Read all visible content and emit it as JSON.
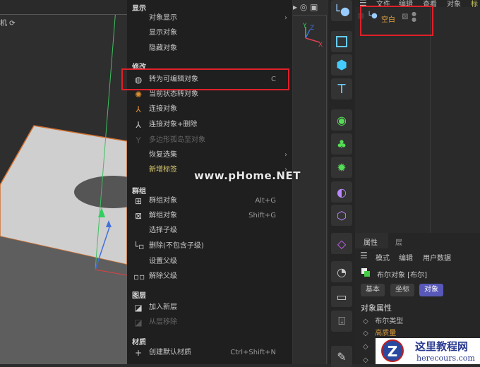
{
  "viewport": {
    "label": "机 ⟳",
    "axes": {
      "x": "X",
      "y": "Y",
      "z": "Z"
    }
  },
  "menu": {
    "sections": [
      {
        "title": "显示",
        "items": [
          {
            "label": "对象显示",
            "submenu": true
          },
          {
            "label": "显示对象"
          },
          {
            "label": "隐藏对象"
          }
        ]
      },
      {
        "title": "修改",
        "items": [
          {
            "label": "转为可编辑对象",
            "shortcut": "C",
            "icon": "make-editable-icon"
          },
          {
            "label": "当前状态转对象",
            "icon": "current-state-icon"
          },
          {
            "label": "连接对象",
            "icon": "connect-icon"
          },
          {
            "label": "连接对象+删除",
            "icon": "connect-delete-icon"
          },
          {
            "label": "多边形孤岛至对象",
            "icon": "polygon-island-icon",
            "disabled": true
          },
          {
            "label": "恢复选集",
            "submenu": true
          },
          {
            "label": "新增标签",
            "submenu": true
          }
        ]
      },
      {
        "title": "群组",
        "items": [
          {
            "label": "群组对象",
            "shortcut": "Alt+G",
            "icon": "group-icon"
          },
          {
            "label": "解组对象",
            "shortcut": "Shift+G",
            "icon": "ungroup-icon"
          },
          {
            "label": "选择子级"
          },
          {
            "label": "删除(不包含子级)",
            "icon": "delete-no-children-icon"
          },
          {
            "label": "设置父级"
          },
          {
            "label": "解除父级",
            "icon": "unparent-icon"
          }
        ]
      },
      {
        "title": "图层",
        "items": [
          {
            "label": "加入新层",
            "icon": "add-layer-icon"
          },
          {
            "label": "从层移除",
            "icon": "remove-layer-icon",
            "disabled": true
          }
        ]
      },
      {
        "title": "材质",
        "items": [
          {
            "label": "创建默认材质",
            "shortcut": "Ctrl+Shift+N",
            "icon": "plus-icon"
          }
        ]
      }
    ]
  },
  "object_manager": {
    "menubar": [
      "文件",
      "编辑",
      "查看",
      "对象",
      "标"
    ],
    "object": {
      "name": "空白"
    }
  },
  "attributes": {
    "tabs": [
      "属性",
      "层"
    ],
    "menubar": [
      "模式",
      "编辑",
      "用户数据"
    ],
    "object_title": "布尔对象 [布尔]",
    "subtabs": [
      "基本",
      "坐标",
      "对象"
    ],
    "active_subtab": "对象",
    "section": "对象属性",
    "props": [
      "布尔类型",
      "高质量"
    ]
  },
  "colors": {
    "accent": "#5858b8",
    "highlight": "#e0202a",
    "new_tag": "#d8c870"
  },
  "watermarks": {
    "site": "www.pHome.NET",
    "logo_title": "这里教程网",
    "logo_url": "herecours.com"
  }
}
